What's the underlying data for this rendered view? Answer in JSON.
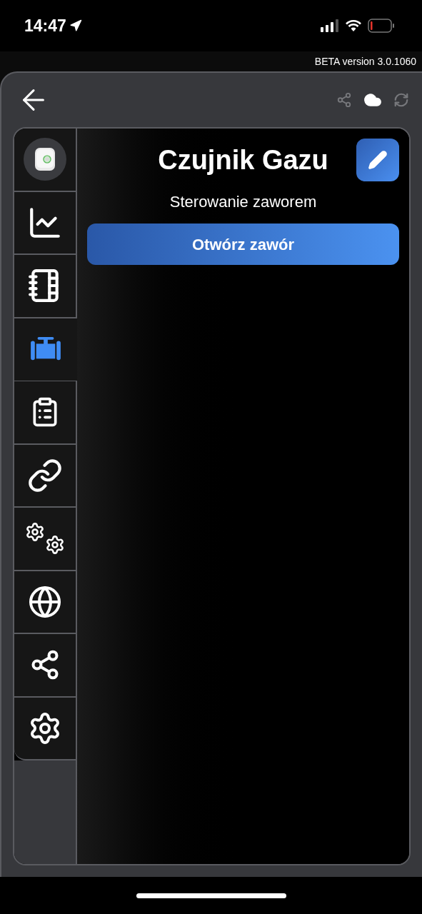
{
  "status_bar": {
    "time": "14:47"
  },
  "version_label": "BETA version 3.0.1060",
  "header_actions": [
    {
      "kind": "share",
      "active": false
    },
    {
      "kind": "cloud",
      "active": true
    },
    {
      "kind": "refresh",
      "active": false
    }
  ],
  "sidebar": {
    "items": [
      {
        "kind": "device",
        "selected": false
      },
      {
        "kind": "chart",
        "selected": false
      },
      {
        "kind": "notebook",
        "selected": false
      },
      {
        "kind": "valve",
        "selected": true
      },
      {
        "kind": "checklist",
        "selected": false
      },
      {
        "kind": "link",
        "selected": false
      },
      {
        "kind": "gears",
        "selected": false
      },
      {
        "kind": "globe",
        "selected": false
      },
      {
        "kind": "share",
        "selected": false
      },
      {
        "kind": "settings",
        "selected": false
      }
    ]
  },
  "content": {
    "title": "Czujnik Gazu",
    "subtitle": "Sterowanie zaworem",
    "action_button": "Otwórz zawór"
  }
}
